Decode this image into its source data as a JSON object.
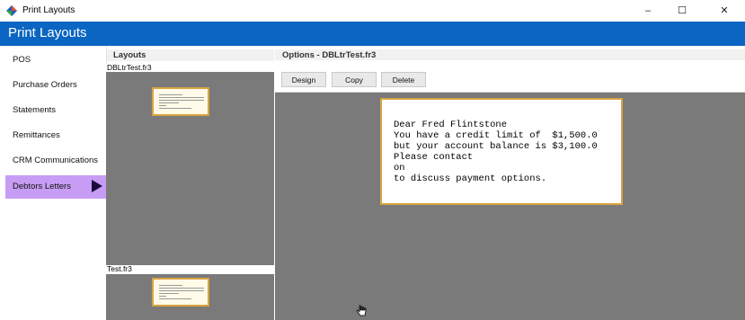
{
  "window": {
    "title": "Print Layouts",
    "controls": {
      "minimize": "–",
      "maximize": "☐",
      "close": "✕"
    }
  },
  "header": {
    "title": "Print Layouts"
  },
  "nav": {
    "items": [
      {
        "label": "POS"
      },
      {
        "label": "Purchase Orders"
      },
      {
        "label": "Statements"
      },
      {
        "label": "Remittances"
      },
      {
        "label": "CRM Communications"
      },
      {
        "label": "Debtors Letters",
        "active": true
      }
    ]
  },
  "layouts": {
    "heading": "Layouts",
    "items": [
      {
        "name": "DBLtrTest.fr3"
      },
      {
        "name": "Test.fr3"
      }
    ]
  },
  "options": {
    "heading": "Options - DBLtrTest.fr3",
    "buttons": {
      "design": "Design",
      "copy": "Copy",
      "delete": "Delete"
    }
  },
  "preview": {
    "lines": [
      "Dear Fred Flintstone",
      "You have a credit limit of  $1,500.0",
      "but your account balance is $3,100.0",
      "Please contact",
      "on",
      "to discuss payment options."
    ]
  },
  "colors": {
    "header": "#0a66c2",
    "active_nav": "#c79cf4",
    "preview_bg": "#7a7a7a",
    "thumb_border": "#d9a441"
  }
}
